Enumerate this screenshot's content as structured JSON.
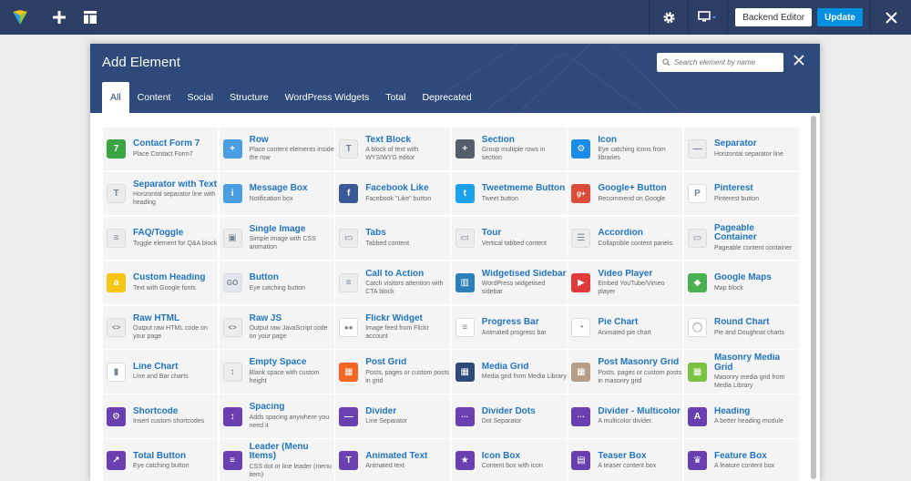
{
  "toolbar": {
    "logo_icon": "vc-logo-icon",
    "backend_editor": "Backend Editor",
    "update": "Update"
  },
  "modal": {
    "title": "Add Element",
    "search_placeholder": "Search element by name",
    "tabs": [
      "All",
      "Content",
      "Social",
      "Structure",
      "WordPress Widgets",
      "Total",
      "Deprecated"
    ]
  },
  "colors": {
    "toolbar_bg": "#2d3f64",
    "header_bg": "#2d4a7a",
    "accent_blue": "#0090e0",
    "element_name": "#2175c0"
  },
  "elements": [
    {
      "name": "Contact Form 7",
      "desc": "Place Contact Form7",
      "icon": "contact-form-7-icon",
      "color": "#3aa543",
      "glyph": "7"
    },
    {
      "name": "Row",
      "desc": "Place content elements inside the row",
      "icon": "plus-icon",
      "color": "#4a9fe3",
      "glyph": "+"
    },
    {
      "name": "Text Block",
      "desc": "A block of text with WYSIWYG editor",
      "icon": "text-block-icon",
      "color": "#ececec",
      "glyph": "T"
    },
    {
      "name": "Section",
      "desc": "Group multiple rows in section",
      "icon": "plus-icon",
      "color": "#555e6b",
      "glyph": "+"
    },
    {
      "name": "Icon",
      "desc": "Eye catching icons from libraries",
      "icon": "gear-icon",
      "color": "#1a8ce8",
      "glyph": "⚙"
    },
    {
      "name": "Separator",
      "desc": "Horizontal separator line",
      "icon": "separator-icon",
      "color": "#ececec",
      "glyph": "—"
    },
    {
      "name": "Separator with Text",
      "desc": "Horizontal separator line with heading",
      "icon": "separator-text-icon",
      "color": "#ececec",
      "glyph": "T"
    },
    {
      "name": "Message Box",
      "desc": "Notification box",
      "icon": "info-icon",
      "color": "#4a9fe3",
      "glyph": "i"
    },
    {
      "name": "Facebook Like",
      "desc": "Facebook \"Like\" button",
      "icon": "facebook-icon",
      "color": "#3b5998",
      "glyph": "f"
    },
    {
      "name": "Tweetmeme Button",
      "desc": "Tweet button",
      "icon": "twitter-icon",
      "color": "#1da1f2",
      "glyph": "t"
    },
    {
      "name": "Google+ Button",
      "desc": "Recommend on Google",
      "icon": "google-plus-icon",
      "color": "#dd4b39",
      "glyph": "g+"
    },
    {
      "name": "Pinterest",
      "desc": "Pinterest button",
      "icon": "pinterest-icon",
      "color": "#ffffff",
      "glyph": "P"
    },
    {
      "name": "FAQ/Toggle",
      "desc": "Toggle element for Q&A block",
      "icon": "toggle-icon",
      "color": "#ececec",
      "glyph": "≡"
    },
    {
      "name": "Single Image",
      "desc": "Simple image with CSS animation",
      "icon": "image-icon",
      "color": "#ececec",
      "glyph": "▣"
    },
    {
      "name": "Tabs",
      "desc": "Tabbed content",
      "icon": "tabs-icon",
      "color": "#ececec",
      "glyph": "▭"
    },
    {
      "name": "Tour",
      "desc": "Vertical tabbed content",
      "icon": "tour-icon",
      "color": "#ececec",
      "glyph": "▭"
    },
    {
      "name": "Accordion",
      "desc": "Collapsible content panels",
      "icon": "accordion-icon",
      "color": "#ececec",
      "glyph": "☰"
    },
    {
      "name": "Pageable Container",
      "desc": "Pageable content container",
      "icon": "pageable-icon",
      "color": "#ececec",
      "glyph": "▭"
    },
    {
      "name": "Custom Heading",
      "desc": "Text with Google fonts",
      "icon": "heading-a-icon",
      "color": "#f5c518",
      "glyph": "a"
    },
    {
      "name": "Button",
      "desc": "Eye catching button",
      "icon": "button-go-icon",
      "color": "#e4e8ee",
      "glyph": "GO"
    },
    {
      "name": "Call to Action",
      "desc": "Catch visitors attention with CTA block",
      "icon": "cta-icon",
      "color": "#ececec",
      "glyph": "≡"
    },
    {
      "name": "Widgetised Sidebar",
      "desc": "WordPress widgetised sidebar",
      "icon": "sidebar-icon",
      "color": "#2c7fb8",
      "glyph": "▥"
    },
    {
      "name": "Video Player",
      "desc": "Embed YouTube/Vimeo player",
      "icon": "video-icon",
      "color": "#e03a3a",
      "glyph": "▶"
    },
    {
      "name": "Google Maps",
      "desc": "Map block",
      "icon": "map-icon",
      "color": "#4caf50",
      "glyph": "◆"
    },
    {
      "name": "Raw HTML",
      "desc": "Output raw HTML code on your page",
      "icon": "html-code-icon",
      "color": "#ececec",
      "glyph": "<>"
    },
    {
      "name": "Raw JS",
      "desc": "Output raw JavaScript code on your page",
      "icon": "js-code-icon",
      "color": "#ececec",
      "glyph": "<>"
    },
    {
      "name": "Flickr Widget",
      "desc": "Image feed from Flickr account",
      "icon": "flickr-icon",
      "color": "#ffffff",
      "glyph": "●●"
    },
    {
      "name": "Progress Bar",
      "desc": "Animated progress bar",
      "icon": "progress-bar-icon",
      "color": "#ffffff",
      "glyph": "≡"
    },
    {
      "name": "Pie Chart",
      "desc": "Animated pie chart",
      "icon": "pie-chart-icon",
      "color": "#ffffff",
      "glyph": "◔"
    },
    {
      "name": "Round Chart",
      "desc": "Pie and Doughnat charts",
      "icon": "round-chart-icon",
      "color": "#ffffff",
      "glyph": "◯"
    },
    {
      "name": "Line Chart",
      "desc": "Line and Bar charts",
      "icon": "bar-chart-icon",
      "color": "#ffffff",
      "glyph": "▮"
    },
    {
      "name": "Empty Space",
      "desc": "Blank space with custom height",
      "icon": "empty-space-icon",
      "color": "#ececec",
      "glyph": "↕"
    },
    {
      "name": "Post Grid",
      "desc": "Posts, pages or custom posts in grid",
      "icon": "post-grid-icon",
      "color": "#f26522",
      "glyph": "▦"
    },
    {
      "name": "Media Grid",
      "desc": "Media grid from Media Library",
      "icon": "media-grid-icon",
      "color": "#2d4a7a",
      "glyph": "▦"
    },
    {
      "name": "Post Masonry Grid",
      "desc": "Posts, pages or custom posts in masonry grid",
      "icon": "masonry-grid-icon",
      "color": "#b59d86",
      "glyph": "▦"
    },
    {
      "name": "Masonry Media Grid",
      "desc": "Masonry media grid from Media Library",
      "icon": "masonry-media-icon",
      "color": "#7cc242",
      "glyph": "▦"
    },
    {
      "name": "Shortcode",
      "desc": "Insert custom shortcodes",
      "icon": "shortcode-gear-icon",
      "color": "#6a3fb0",
      "glyph": "⚙"
    },
    {
      "name": "Spacing",
      "desc": "Adds spacing anywhere you need it",
      "icon": "spacing-icon",
      "color": "#6a3fb0",
      "glyph": "↕"
    },
    {
      "name": "Divider",
      "desc": "Line Separator",
      "icon": "divider-icon",
      "color": "#6a3fb0",
      "glyph": "—"
    },
    {
      "name": "Divider Dots",
      "desc": "Dot Separator",
      "icon": "divider-dots-icon",
      "color": "#6a3fb0",
      "glyph": "···"
    },
    {
      "name": "Divider - Multicolor",
      "desc": "A multicolor divider.",
      "icon": "divider-multicolor-icon",
      "color": "#6a3fb0",
      "glyph": "···"
    },
    {
      "name": "Heading",
      "desc": "A better heading module",
      "icon": "heading-icon",
      "color": "#6a3fb0",
      "glyph": "A"
    },
    {
      "name": "Total Button",
      "desc": "Eye catching button",
      "icon": "external-link-icon",
      "color": "#6a3fb0",
      "glyph": "↗"
    },
    {
      "name": "Leader (Menu Items)",
      "desc": "CSS dot or line leader (menu item)",
      "icon": "leader-icon",
      "color": "#6a3fb0",
      "glyph": "≡"
    },
    {
      "name": "Animated Text",
      "desc": "Animated text",
      "icon": "animated-text-icon",
      "color": "#6a3fb0",
      "glyph": "T"
    },
    {
      "name": "Icon Box",
      "desc": "Content box with icon",
      "icon": "star-icon",
      "color": "#6a3fb0",
      "glyph": "★"
    },
    {
      "name": "Teaser Box",
      "desc": "A teaser content box",
      "icon": "teaser-icon",
      "color": "#6a3fb0",
      "glyph": "▤"
    },
    {
      "name": "Feature Box",
      "desc": "A feature content box",
      "icon": "trophy-icon",
      "color": "#6a3fb0",
      "glyph": "♛"
    }
  ]
}
